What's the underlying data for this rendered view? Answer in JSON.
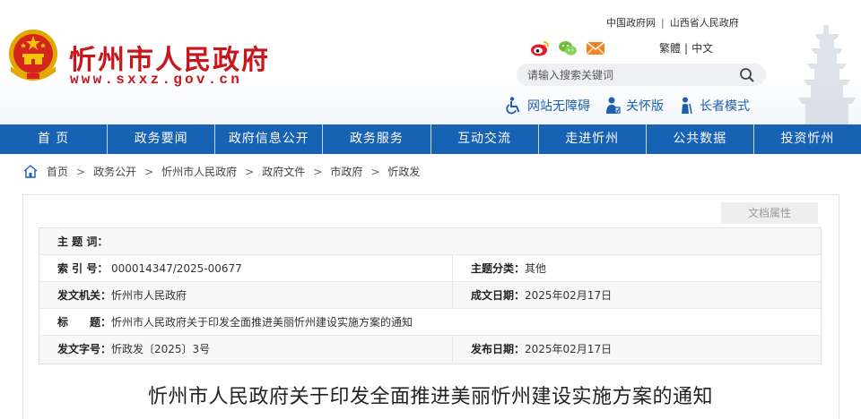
{
  "header": {
    "site_name": "忻州市人民政府",
    "site_url": "www.sxxz.gov.cn",
    "top_links": [
      "中国政府网",
      "山西省人民政府"
    ],
    "lang_traditional": "繁體",
    "lang_simplified": "中文",
    "search_placeholder": "请输入搜索关键词",
    "access": {
      "barrier_free": "网站无障碍",
      "care_version": "关怀版",
      "elder_mode": "长者模式"
    },
    "icons": [
      "weibo-icon",
      "wechat-icon",
      "email-icon",
      "search-icon",
      "wheelchair-icon",
      "care-icon",
      "elder-icon"
    ],
    "colors": {
      "brand_red": "#c8161d",
      "nav_blue": "#1762b3",
      "access_blue": "#1b5fae"
    }
  },
  "nav": [
    "首 页",
    "政务要闻",
    "政府信息公开",
    "政务服务",
    "互动交流",
    "走进忻州",
    "公共数据",
    "投资忻州"
  ],
  "breadcrumb": [
    "首页",
    "政务公开",
    "忻州市人民政府",
    "政府文件",
    "市政府",
    "忻政发"
  ],
  "breadcrumb_separator": ">",
  "panel": {
    "tab_label": "文档属性",
    "meta": {
      "keywords_label": "主 题 词：",
      "keywords_value": "",
      "index_label": "索 引 号：",
      "index_value": "000014347/2025-00677",
      "category_label": "主题分类：",
      "category_value": "其他",
      "issuer_label": "发文机关：",
      "issuer_value": "忻州市人民政府",
      "created_label": "成文日期：",
      "created_value": "2025年02月17日",
      "title_label": "标　　题：",
      "title_value": "忻州市人民政府关于印发全面推进美丽忻州建设实施方案的通知",
      "docno_label": "发文字号：",
      "docno_value": "忻政发〔2025〕3号",
      "published_label": "发布日期：",
      "published_value": "2025年02月17日"
    }
  },
  "document_title": "忻州市人民政府关于印发全面推进美丽忻州建设实施方案的通知"
}
